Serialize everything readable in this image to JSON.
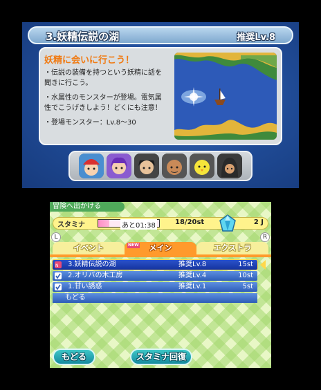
{
  "top": {
    "title": "3.妖精伝説の湖",
    "recommended": "推奨Lv.8",
    "desc_heading": "妖精に会いに行こう！",
    "desc_lines": [
      "・伝説の装備を持つという妖精に話を",
      "聞きに行こう。",
      "・水属性のモンスターが登場。電気属",
      "性でこうげきしよう！どくにも注意！",
      "・登場モンスター：Lv.8〜30"
    ],
    "party_icons": [
      "red-cap-kid-icon",
      "purple-hair-mii-icon",
      "dark-mask-mii-icon",
      "bald-mii-icon",
      "yellow-chick-mii-icon",
      "hooded-mii-icon"
    ]
  },
  "bottom": {
    "breadcrumb": "冒険へ出かける",
    "stamina_label": "スタミナ",
    "stamina_timer": "あと01:38",
    "stamina_fill": 0.18,
    "stamina_count": "18/20st",
    "jewel_count": "2 J",
    "tab_l": "L",
    "tab_r": "R",
    "tabs": [
      "イベント",
      "メイン",
      "エクストラ"
    ],
    "new_badge": "NEW",
    "quests": [
      {
        "name": "3.妖精伝説の湖",
        "level": "推奨Lv.8",
        "stamina": "15st",
        "marker": "NEW",
        "selected": true
      },
      {
        "name": "2.オリバの木工房",
        "level": "推奨Lv.4",
        "stamina": "10st",
        "marker": "check",
        "selected": false
      },
      {
        "name": "1.甘い誘惑",
        "level": "推奨Lv.1",
        "stamina": "5st",
        "marker": "check",
        "selected": false
      }
    ],
    "back_row": "もどる",
    "back_button": "もどる",
    "stamina_button": "スタミナ回復"
  },
  "colors": {
    "accent_orange": "#ff9a2c",
    "row_blue": "#2d5db8",
    "button_teal": "#158a9e"
  }
}
